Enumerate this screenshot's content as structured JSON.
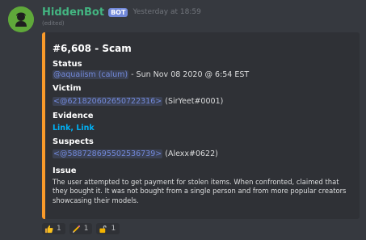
{
  "message": {
    "username": "HiddenBot",
    "bot_tag": "BOT",
    "timestamp": "Yesterday at 18:59",
    "edited": "(edited)"
  },
  "embed": {
    "accent_color": "#f99a2a",
    "title": "#6,608 - Scam",
    "status": {
      "name": "Status",
      "mention": "@aquaiism (calum)",
      "text": " - Sun Nov 08 2020 @ 6:54 EST"
    },
    "victim": {
      "name": "Victim",
      "mention": "<@621820602650722316>",
      "text": " (SirYeet#0001)"
    },
    "evidence": {
      "name": "Evidence",
      "link1": "Link",
      "separator": ", ",
      "link2": "Link"
    },
    "suspects": {
      "name": "Suspects",
      "mention": "<@588728695502536739>",
      "text": " (Alexx#0622)"
    },
    "issue": {
      "name": "Issue",
      "text": "The user attempted to get payment for stolen items. When confronted, claimed that they bought it. It was not bought from a single person and from more popular creators showcasing their models."
    }
  },
  "reactions": [
    {
      "icon": "thumbs-up-icon",
      "count": "1"
    },
    {
      "icon": "pencil-icon",
      "count": "1"
    },
    {
      "icon": "unlocked-icon",
      "count": "1"
    }
  ],
  "colors": {
    "background": "#36393f",
    "embed_background": "#2f3136",
    "username": "#43b581",
    "bot_tag": "#7289da",
    "mention": "#7289da",
    "link": "#00b0f4"
  }
}
